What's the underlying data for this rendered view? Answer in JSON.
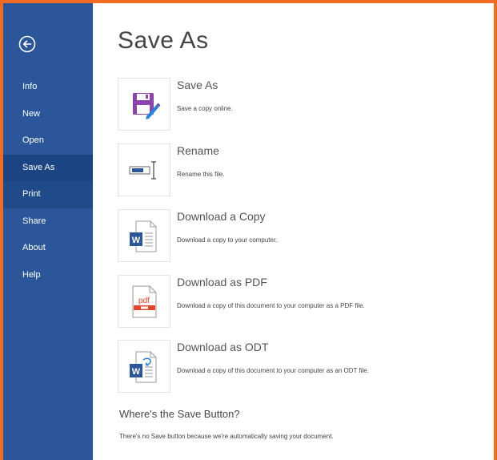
{
  "nav": {
    "items": [
      {
        "label": "Info"
      },
      {
        "label": "New"
      },
      {
        "label": "Open"
      },
      {
        "label": "Save As"
      },
      {
        "label": "Print"
      },
      {
        "label": "Share"
      },
      {
        "label": "About"
      },
      {
        "label": "Help"
      }
    ],
    "selected": "Save As",
    "back_icon": "back-arrow-icon"
  },
  "page": {
    "title": "Save As"
  },
  "options": [
    {
      "title": "Save As",
      "description": "Save a copy online.",
      "icon": "save-as-icon"
    },
    {
      "title": "Rename",
      "description": "Rename this file.",
      "icon": "rename-icon"
    },
    {
      "title": "Download a Copy",
      "description": "Download a copy to your computer.",
      "icon": "word-document-icon"
    },
    {
      "title": "Download as PDF",
      "description": "Download a copy of this document to your computer as a PDF file.",
      "icon": "pdf-document-icon",
      "icon_text": "pdf"
    },
    {
      "title": "Download as ODT",
      "description": "Download a copy of this document to your computer as an ODT file.",
      "icon": "odt-document-icon"
    }
  ],
  "info": {
    "title": "Where's the Save Button?",
    "text": "There's no Save button because we're automatically saving your document."
  },
  "colors": {
    "frame": "#f26b22",
    "sidebar": "#2b579a",
    "sidebar_selected": "#1a4582",
    "save_icon": "#8e44ad",
    "word_icon": "#2b579a",
    "pdf_icon": "#e2472a"
  }
}
